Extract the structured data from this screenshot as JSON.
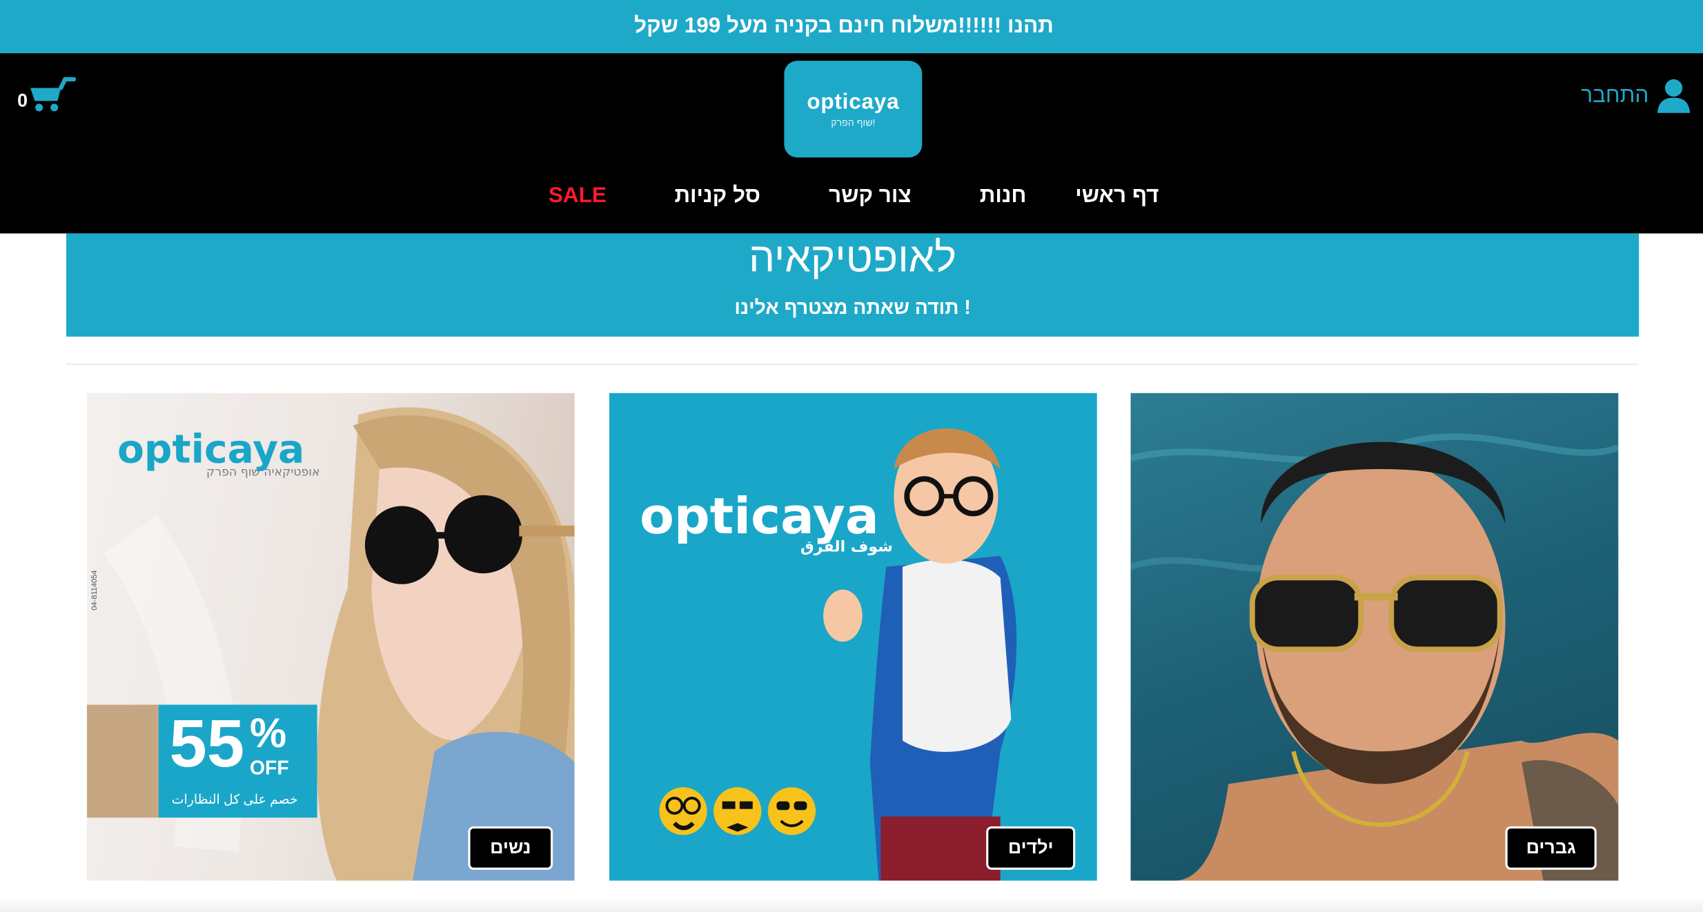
{
  "announcement": {
    "text": "תהנו !!!!!!משלוח חינם בקניה מעל 199 שקל"
  },
  "header": {
    "cart_count": "0",
    "login_label": "התחבר",
    "logo": {
      "word": "opticaya",
      "tagline": "שוף הפרק!"
    }
  },
  "nav": {
    "items": [
      {
        "label": "דף ראשי"
      },
      {
        "label": "חנות"
      },
      {
        "label": "צור קשר"
      },
      {
        "label": "סל קניות"
      },
      {
        "label": "SALE"
      }
    ]
  },
  "welcome": {
    "title": "לאופטיקאיה",
    "subtitle": "תודה שאתה מצטרף אלינו !"
  },
  "categories": {
    "women": {
      "button": "נשים",
      "brand": "opticaya",
      "brand_tag": "אופטיקאיה שוף הפרק",
      "promo_number": "55",
      "promo_percent": "%",
      "promo_off": "OFF",
      "promo_sub": "خصم على كل النظارات",
      "phone": "04-8114054"
    },
    "kids": {
      "button": "ילדים",
      "brand": "opticaya",
      "brand_tag": "شوف الفرق"
    },
    "men": {
      "button": "גברים"
    }
  },
  "colors": {
    "accent": "#1fa9c9",
    "header_bg": "#000000",
    "sale": "#ff1a2e"
  }
}
